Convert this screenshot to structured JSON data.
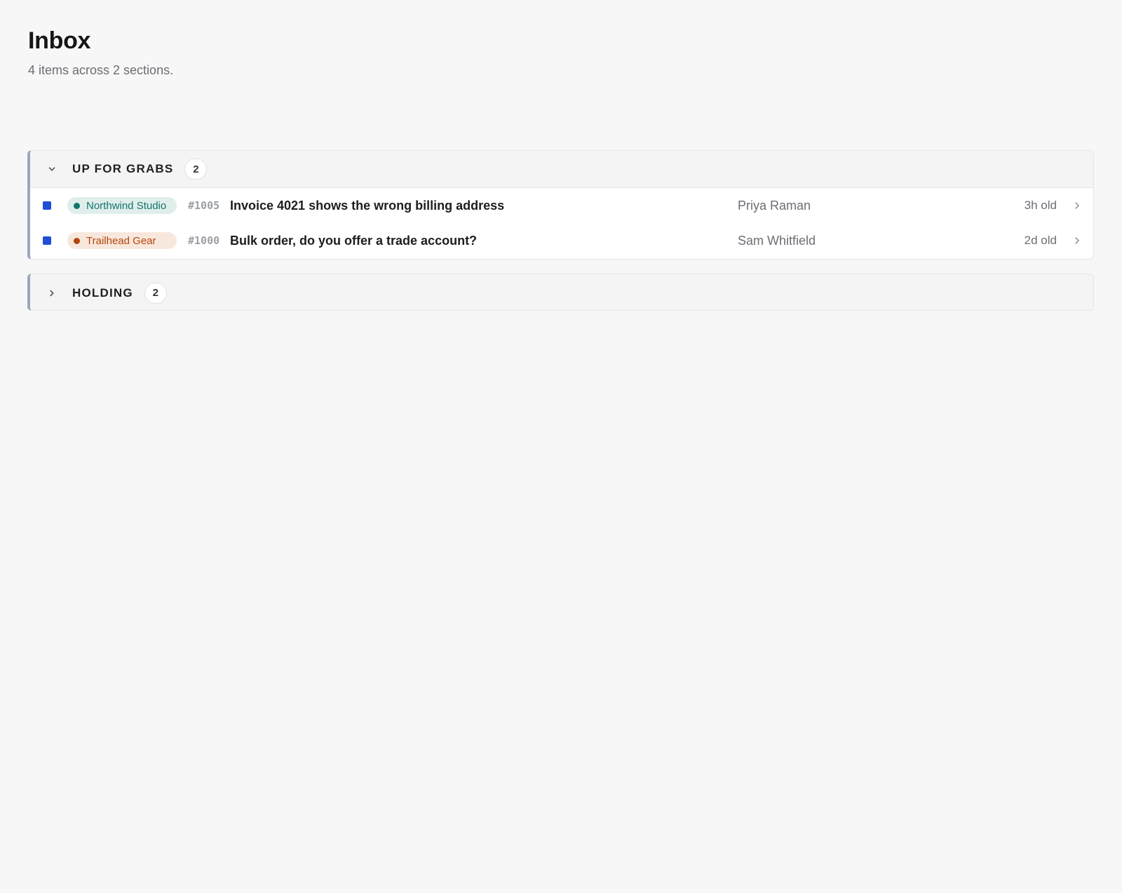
{
  "page": {
    "title": "Inbox",
    "subtitle": "4 items across 2 sections."
  },
  "sections": [
    {
      "title": "UP FOR GRABS",
      "count": "2",
      "expanded": true,
      "items": [
        {
          "tag": {
            "label": "Northwind Studio",
            "color": "#0f766e",
            "background": "#e0eeeb"
          },
          "id": "#1005",
          "subject": "Invoice 4021 shows the wrong billing address",
          "customer": "Priya Raman",
          "age": "3h old"
        },
        {
          "tag": {
            "label": "Trailhead Gear",
            "color": "#b4450c",
            "background": "#f8e7dc"
          },
          "id": "#1000",
          "subject": "Bulk order, do you offer a trade account?",
          "customer": "Sam Whitfield",
          "age": "2d old"
        }
      ]
    },
    {
      "title": "HOLDING",
      "count": "2",
      "expanded": false,
      "items": []
    }
  ],
  "colors": {
    "unread_marker": "#1f4fd6",
    "section_accent": "#9aa7bc"
  },
  "icons": {
    "expanded": "chevron-down-icon",
    "collapsed": "chevron-right-icon",
    "row_open": "chevron-right-icon"
  }
}
